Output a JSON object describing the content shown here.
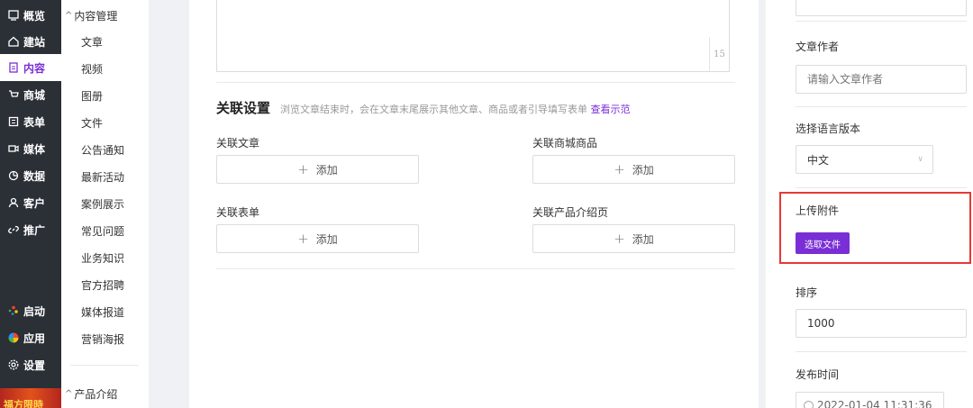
{
  "primary_nav": [
    {
      "label": "概览",
      "icon": "overview-icon"
    },
    {
      "label": "建站",
      "icon": "home-icon"
    },
    {
      "label": "内容",
      "icon": "document-icon",
      "active": true
    },
    {
      "label": "商城",
      "icon": "cart-icon"
    },
    {
      "label": "表单",
      "icon": "form-icon"
    },
    {
      "label": "媒体",
      "icon": "video-icon"
    },
    {
      "label": "数据",
      "icon": "chart-icon"
    },
    {
      "label": "客户",
      "icon": "user-icon"
    },
    {
      "label": "推广",
      "icon": "link-icon"
    }
  ],
  "primary_bottom": [
    {
      "label": "启动",
      "icon": "launch-icon"
    },
    {
      "label": "应用",
      "icon": "apps-icon"
    },
    {
      "label": "设置",
      "icon": "settings-icon"
    }
  ],
  "promo_text": "福方限時",
  "secondary_nav": {
    "group1": "内容管理",
    "items": [
      "文章",
      "视频",
      "图册",
      "文件",
      "公告通知",
      "最新活动",
      "案例展示",
      "常见问题",
      "业务知识",
      "官方招聘",
      "媒体报道",
      "营销海报"
    ],
    "group2": "产品介绍"
  },
  "editor": {
    "word_count": "15"
  },
  "related": {
    "title": "关联设置",
    "description": "浏览文章结束时，会在文章末尾展示其他文章、商品或者引导填写表单",
    "link": "查看示范",
    "fields": [
      {
        "label": "关联文章",
        "button": "添加"
      },
      {
        "label": "关联商城商品",
        "button": "添加"
      },
      {
        "label": "关联表单",
        "button": "添加"
      },
      {
        "label": "关联产品介绍页",
        "button": "添加"
      }
    ]
  },
  "right": {
    "author_label": "文章作者",
    "author_placeholder": "请输入文章作者",
    "lang_label": "选择语言版本",
    "lang_value": "中文",
    "upload_label": "上传附件",
    "upload_button": "选取文件",
    "sort_label": "排序",
    "sort_value": "1000",
    "publish_label": "发布时间",
    "publish_value": "2022-01-04 11:31:36"
  },
  "colors": {
    "accent": "#7a2fd6",
    "highlight": "#e53935",
    "sidebar_bg": "#2b2f36"
  }
}
